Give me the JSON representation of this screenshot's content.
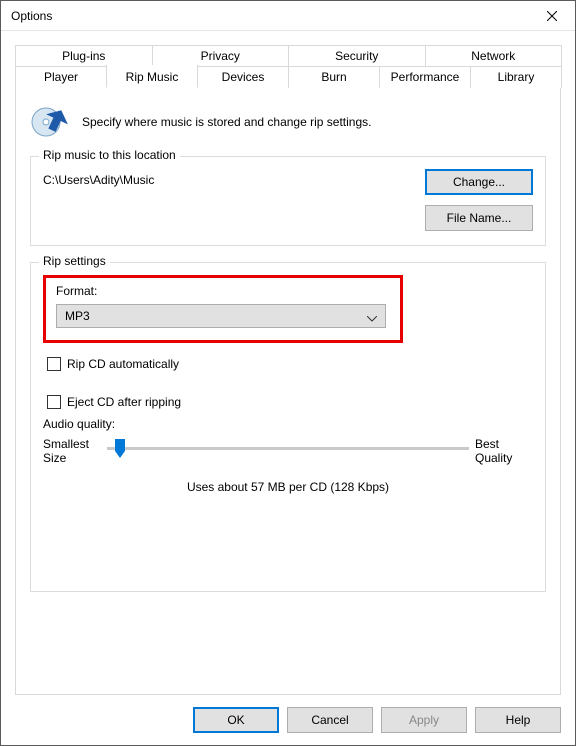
{
  "window": {
    "title": "Options"
  },
  "tabs": {
    "row1": [
      "Plug-ins",
      "Privacy",
      "Security",
      "Network"
    ],
    "row2": [
      "Player",
      "Rip Music",
      "Devices",
      "Burn",
      "Performance",
      "Library"
    ],
    "active": "Rip Music"
  },
  "header": {
    "text": "Specify where music is stored and change rip settings."
  },
  "location_group": {
    "legend": "Rip music to this location",
    "path": "C:\\Users\\Adity\\Music",
    "change_btn": "Change...",
    "filename_btn": "File Name..."
  },
  "settings_group": {
    "legend": "Rip settings",
    "format_label": "Format:",
    "format_value": "MP3",
    "rip_auto_label": "Rip CD automatically",
    "rip_auto_checked": false,
    "eject_label": "Eject CD after ripping",
    "eject_checked": false,
    "quality_label": "Audio quality:",
    "quality_left_l1": "Smallest",
    "quality_left_l2": "Size",
    "quality_right_l1": "Best",
    "quality_right_l2": "Quality",
    "quality_note": "Uses about 57 MB per CD (128 Kbps)"
  },
  "footer": {
    "ok": "OK",
    "cancel": "Cancel",
    "apply": "Apply",
    "help": "Help"
  }
}
